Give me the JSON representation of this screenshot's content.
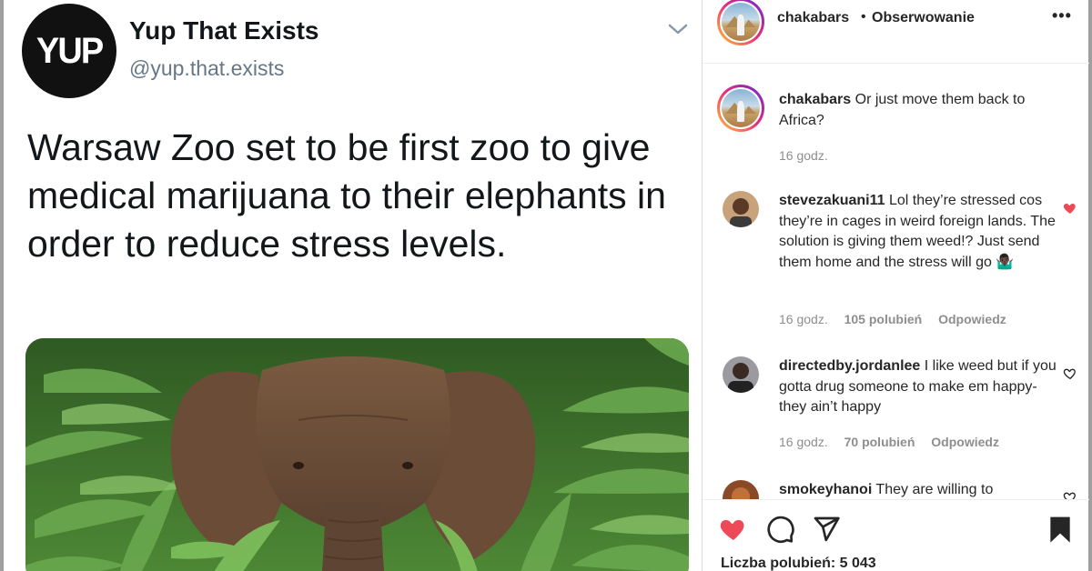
{
  "tweet": {
    "avatar_text": "YUP",
    "name": "Yup That Exists",
    "handle": "@yup.that.exists",
    "text": "Warsaw Zoo set to be first zoo to give medical marijuana to their elephants in order to reduce stress levels."
  },
  "post": {
    "header": {
      "username": "chakabars",
      "separator": "•",
      "follow_label": "Obserwowanie",
      "more_label": "•••"
    },
    "caption": {
      "username": "chakabars",
      "text": "Or just move them back to Africa?",
      "time": "16 godz."
    },
    "comments": [
      {
        "username": "stevezakuani11",
        "text": "Lol they’re stressed cos they’re in cages in weird foreign lands. The solution is giving them weed!? Just send them home and the stress will go 🤷🏿‍♂️",
        "time": "16 godz.",
        "likes": "105 polubień",
        "reply": "Odpowiedz",
        "liked": true
      },
      {
        "username": "directedby.jordanlee",
        "text": "I like weed but if you gotta drug someone to make em happy- they ain’t happy",
        "time": "16 godz.",
        "likes": "70 polubień",
        "reply": "Odpowiedz",
        "liked": false
      },
      {
        "username": "smokeyhanoi",
        "text": "They are willing to",
        "liked": false
      }
    ],
    "likes_label": "Liczba polubień: 5 043",
    "liked_by_me": true,
    "colors": {
      "like_red": "#ed4956",
      "text_dark": "#262626",
      "meta_grey": "#8e8e8e"
    },
    "icons": [
      "heart-filled-icon",
      "comment-icon",
      "share-icon",
      "bookmark-filled-icon"
    ]
  }
}
